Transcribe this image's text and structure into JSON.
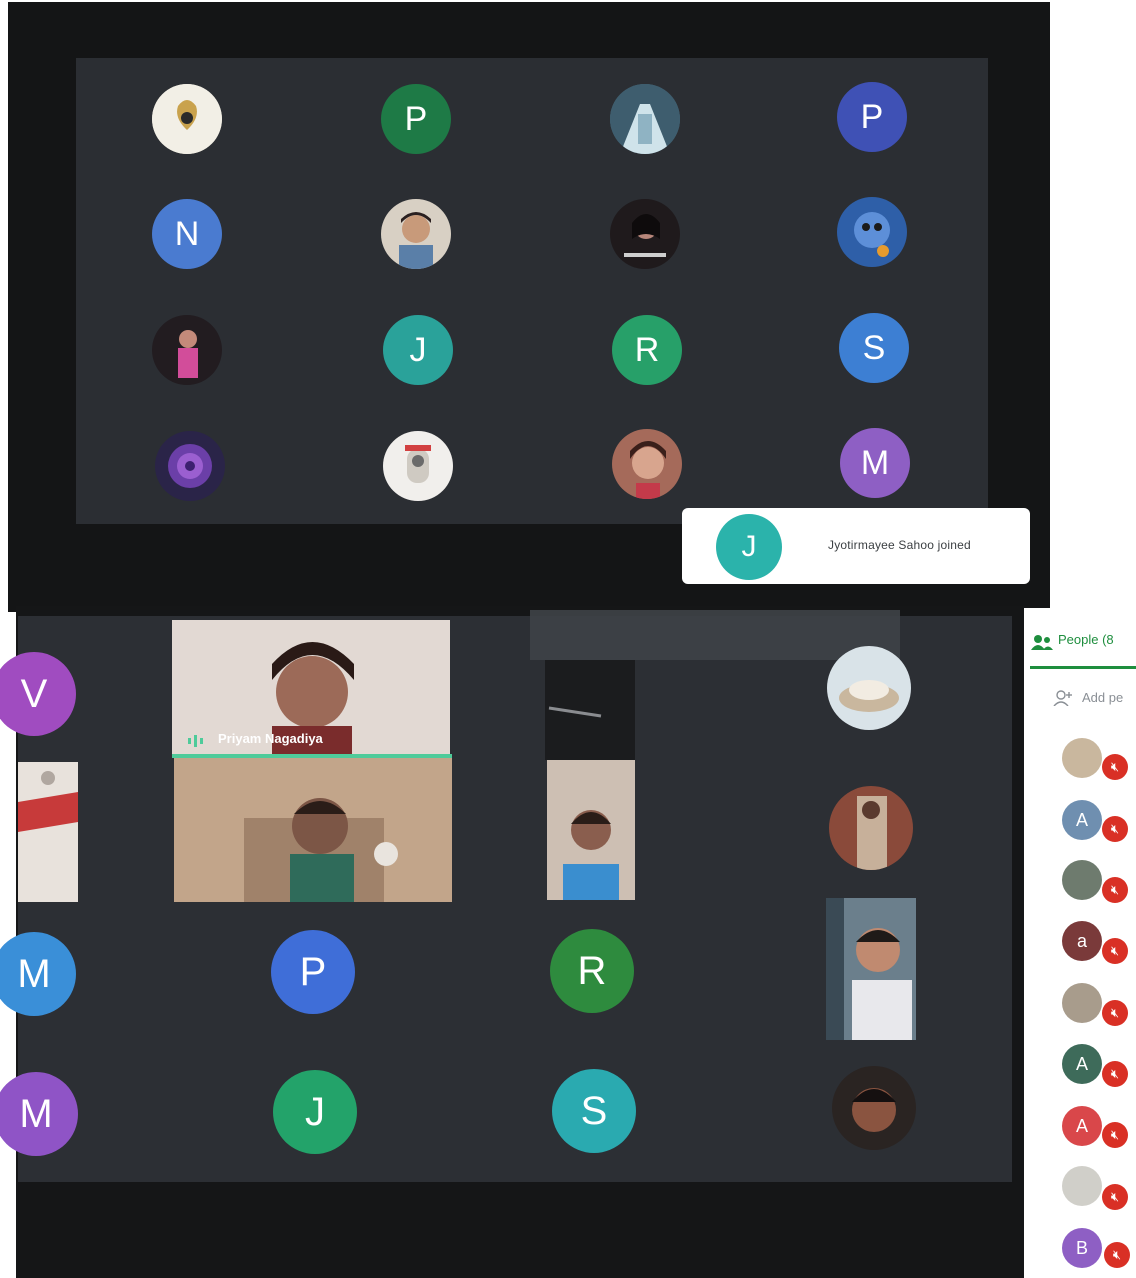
{
  "grid_top": {
    "row1": [
      {
        "name": "participant-1-1",
        "initial": "",
        "color": "#d7d2c2"
      },
      {
        "name": "participant-1-2",
        "initial": "P",
        "color": "#1e7a46"
      },
      {
        "name": "participant-1-3",
        "initial": "",
        "color": "#4a6b7c"
      },
      {
        "name": "participant-1-4",
        "initial": "P",
        "color": "#3f51b5"
      }
    ],
    "row2": [
      {
        "name": "participant-2-1",
        "initial": "N",
        "color": "#4a7bd0"
      },
      {
        "name": "participant-2-2",
        "initial": "",
        "color": "#c5b7a9"
      },
      {
        "name": "participant-2-3",
        "initial": "",
        "color": "#2b2224"
      },
      {
        "name": "participant-2-4",
        "initial": "",
        "color": "#3a6fb0"
      }
    ],
    "row3": [
      {
        "name": "participant-3-1",
        "initial": "",
        "color": "#3b2a33"
      },
      {
        "name": "participant-3-2",
        "initial": "J",
        "color": "#2aa29a"
      },
      {
        "name": "participant-3-3",
        "initial": "R",
        "color": "#27a069"
      },
      {
        "name": "participant-3-4",
        "initial": "S",
        "color": "#3d7fd3"
      }
    ],
    "row4": [
      {
        "name": "participant-4-1",
        "initial": "",
        "color": "#4b3f8a"
      },
      {
        "name": "participant-4-2",
        "initial": "",
        "color": "#e8e6e2"
      },
      {
        "name": "participant-4-3",
        "initial": "",
        "color": "#b07a6c"
      },
      {
        "name": "participant-4-4",
        "initial": "M",
        "color": "#8e5fc4"
      }
    ]
  },
  "toast": {
    "initial": "J",
    "text": "Jyotirmayee Sahoo joined",
    "color": "#2bb3ab"
  },
  "grid_bottom": {
    "v": {
      "initial": "V",
      "color": "#a04cc0"
    },
    "m1": {
      "initial": "M",
      "color": "#3a8fd8"
    },
    "p": {
      "initial": "P",
      "color": "#3f6ed8"
    },
    "r": {
      "initial": "R",
      "color": "#2e8b3e"
    },
    "m2": {
      "initial": "M",
      "color": "#8f54c6"
    },
    "j": {
      "initial": "J",
      "color": "#23a36a"
    },
    "s": {
      "initial": "S",
      "color": "#2aaab0"
    }
  },
  "video_tile": {
    "name": "Priyam Nagadiya",
    "speaking_color": "#4ecb9a"
  },
  "people_panel": {
    "tab_label": "People (8",
    "add_label": "Add pe",
    "accent": "#1e8e3e",
    "participants": [
      {
        "initial": "",
        "color": "#c9b79e"
      },
      {
        "initial": "A",
        "color": "#6f8fb0"
      },
      {
        "initial": "",
        "color": "#6e7b6e"
      },
      {
        "initial": "a",
        "color": "#7a3a3a"
      },
      {
        "initial": "",
        "color": "#a89c8c"
      },
      {
        "initial": "A",
        "color": "#3e6b5a"
      },
      {
        "initial": "A",
        "color": "#d9474a"
      },
      {
        "initial": "",
        "color": "#d0cfc9"
      },
      {
        "initial": "B",
        "color": "#8e5fc4"
      }
    ]
  }
}
